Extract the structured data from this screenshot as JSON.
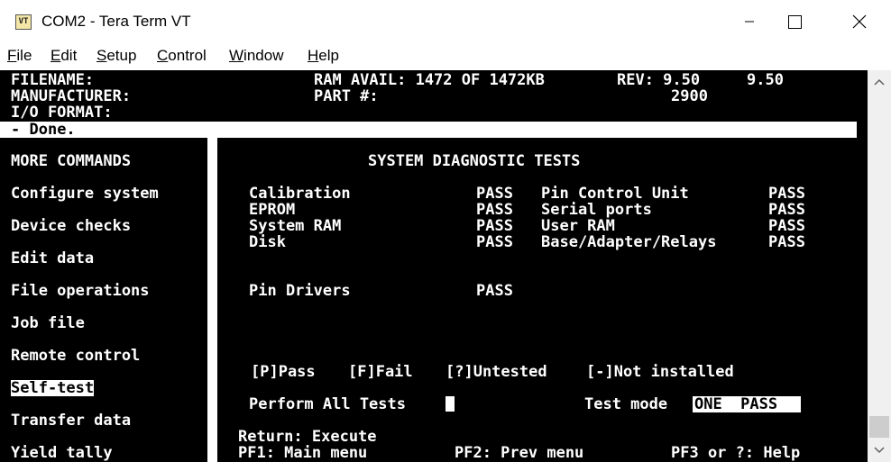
{
  "window": {
    "title": "COM2 - Tera Term VT",
    "icon_label": "VT",
    "icon_name": "teraterm-app-icon"
  },
  "menu": {
    "items": [
      {
        "pre": "",
        "u": "F",
        "rest": "ile"
      },
      {
        "pre": "",
        "u": "E",
        "rest": "dit"
      },
      {
        "pre": "",
        "u": "S",
        "rest": "etup"
      },
      {
        "pre": "",
        "u": "C",
        "rest": "ontrol"
      },
      {
        "pre": "",
        "u": "W",
        "rest": "indow"
      },
      {
        "pre": "",
        "u": "H",
        "rest": "elp"
      }
    ]
  },
  "header": {
    "filename_label": "FILENAME:",
    "manufacturer_label": "MANUFACTURER:",
    "io_label": "I/O FORMAT:",
    "ram_label": "RAM AVAIL: 1472 OF 1472KB",
    "part_label": "PART #:",
    "rev_label": "REV: 9.50",
    "rev_value": "9.50",
    "part_value": "2900"
  },
  "status": {
    "prefix": "- ",
    "text": "Done."
  },
  "sidebar": {
    "heading": "MORE COMMANDS",
    "items": [
      "Configure system",
      "Device checks",
      "Edit data",
      "File operations",
      "Job file",
      "Remote control",
      "Self-test",
      "Transfer data",
      "Yield tally"
    ],
    "selected_index": 6
  },
  "panel": {
    "title": "SYSTEM DIAGNOSTIC TESTS",
    "tests_left": [
      {
        "name": "Calibration",
        "result": "PASS"
      },
      {
        "name": "EPROM",
        "result": "PASS"
      },
      {
        "name": "System RAM",
        "result": "PASS"
      },
      {
        "name": "Disk",
        "result": "PASS"
      }
    ],
    "tests_right": [
      {
        "name": "Pin Control Unit",
        "result": "PASS"
      },
      {
        "name": "Serial ports",
        "result": "PASS"
      },
      {
        "name": "User RAM",
        "result": "PASS"
      },
      {
        "name": "Base/Adapter/Relays",
        "result": "PASS"
      }
    ],
    "pin_drivers": {
      "name": "Pin Drivers",
      "result": "PASS"
    },
    "legend": {
      "pass": "[P]Pass",
      "fail": "[F]Fail",
      "untested": "[?]Untested",
      "not_installed": "[-]Not installed"
    },
    "perform_label": "Perform All Tests",
    "test_mode_label": "Test mode",
    "test_mode_value": "ONE  PASS"
  },
  "footer": {
    "return": "Return: Execute",
    "pf1": "PF1: Main menu",
    "pf2": "PF2: Prev menu",
    "pf3": "PF3 or ?: Help"
  },
  "colors": {
    "terminal_bg": "#000000",
    "terminal_fg": "#ffffff",
    "window_bg": "#ffffff"
  }
}
